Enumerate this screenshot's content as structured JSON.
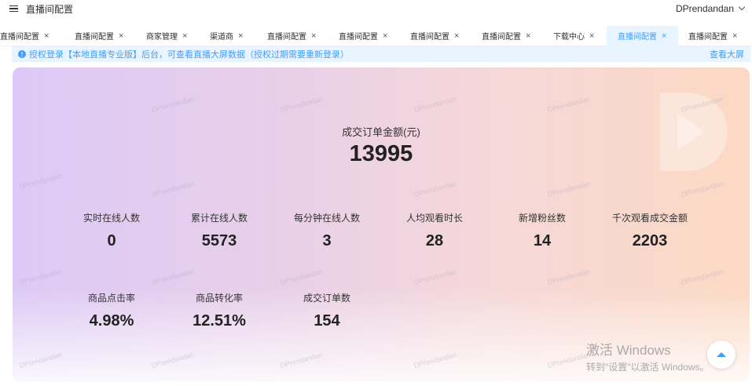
{
  "header": {
    "title": "直播间配置",
    "user": "DPrendandan"
  },
  "tabs": [
    {
      "label": "直播间配置"
    },
    {
      "label": "直播间配置"
    },
    {
      "label": "商家管理"
    },
    {
      "label": "渠道商"
    },
    {
      "label": "直播间配置"
    },
    {
      "label": "直播间配置"
    },
    {
      "label": "直播间配置"
    },
    {
      "label": "直播间配置"
    },
    {
      "label": "下载中心"
    },
    {
      "label": "直播间配置",
      "active": true
    },
    {
      "label": "直播间配置"
    }
  ],
  "banner": {
    "message": "授权登录【本地直播专业版】后台，可查看直播大屏数据（授权过期需要重新登录）",
    "link": "查看大屏"
  },
  "main_stat": {
    "label": "成交订单金额(元)",
    "value": "13995"
  },
  "stats": [
    {
      "label": "实时在线人数",
      "value": "0"
    },
    {
      "label": "累计在线人数",
      "value": "5573"
    },
    {
      "label": "每分钟在线人数",
      "value": "3"
    },
    {
      "label": "人均观看时长",
      "value": "28"
    },
    {
      "label": "新增粉丝数",
      "value": "14"
    },
    {
      "label": "千次观看成交金额",
      "value": "2203"
    },
    {
      "label": "商品点击率",
      "value": "4.98%"
    },
    {
      "label": "商品转化率",
      "value": "12.51%"
    },
    {
      "label": "成交订单数",
      "value": "154"
    }
  ],
  "watermark": "DPrendandan",
  "windows_activation": {
    "title": "激活 Windows",
    "subtitle": "转到\"设置\"以激活 Windows。"
  },
  "colors": {
    "accent": "#409eff",
    "banner_bg": "#e8f4ff"
  }
}
